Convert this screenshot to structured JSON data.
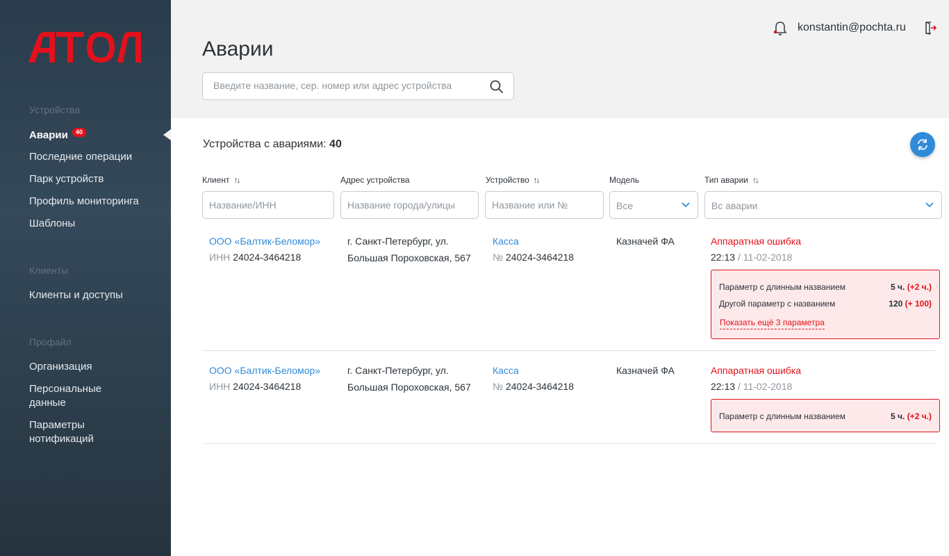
{
  "sidebar": {
    "logo_text": "АТОЛ",
    "sections": [
      {
        "title": "Устройства",
        "items": [
          {
            "label": "Аварии",
            "badge": "40",
            "active": true
          },
          {
            "label": "Последние операции"
          },
          {
            "label": "Парк устройств"
          },
          {
            "label": "Профиль мониторинга"
          },
          {
            "label": "Шаблоны"
          }
        ]
      },
      {
        "title": "Клиенты",
        "items": [
          {
            "label": "Клиенты и доступы"
          }
        ]
      },
      {
        "title": "Профайл",
        "items": [
          {
            "label": "Организация"
          },
          {
            "label": "Персональные данные"
          },
          {
            "label": "Параметры нотификаций"
          }
        ]
      }
    ]
  },
  "header": {
    "title": "Аварии",
    "search_placeholder": "Введите название, сер. номер или адрес устройства",
    "user_email": "konstantin@pochta.ru",
    "icons": [
      "bell-icon",
      "logout-icon",
      "search-icon"
    ]
  },
  "summary": {
    "label": "Устройства с авариями:",
    "count": "40"
  },
  "columns": [
    {
      "label": "Клиент",
      "sortable": true,
      "filter_placeholder": "Название/ИНН"
    },
    {
      "label": "Адрес устройства",
      "sortable": false,
      "filter_placeholder": "Название города/улицы"
    },
    {
      "label": "Устройство",
      "sortable": true,
      "filter_placeholder": "Название или №"
    },
    {
      "label": "Модель",
      "sortable": false,
      "filter_value": "Все"
    },
    {
      "label": "Тип аварии",
      "sortable": true,
      "filter_value": "Вс аварии"
    }
  ],
  "rows": [
    {
      "client_name": "ООО «Балтик-Беломор»",
      "client_inn_label": "ИНН",
      "client_inn": "24024-3464218",
      "address_line1": "г. Санкт-Петербург, ул.",
      "address_line2": "Большая Пороховская, 567",
      "device_name": "Касса",
      "device_no_label": "№",
      "device_no": "24024-3464218",
      "model": "Казначей ФА",
      "alarm_type": "Аппаратная ошибка",
      "alarm_time": "22:13",
      "alarm_date": "/ 11-02-2018",
      "params": [
        {
          "name": "Параметр с длинным названием",
          "value": "5 ч.",
          "delta": "(+2 ч.)"
        },
        {
          "name": "Другой параметр с названием",
          "value": "120",
          "delta": "(+ 100)"
        }
      ],
      "show_more": "Показать ещё 3 параметра"
    },
    {
      "client_name": "ООО «Балтик-Беломор»",
      "client_inn_label": "ИНН",
      "client_inn": "24024-3464218",
      "address_line1": "г. Санкт-Петербург, ул.",
      "address_line2": "Большая Пороховская, 567",
      "device_name": "Касса",
      "device_no_label": "№",
      "device_no": "24024-3464218",
      "model": "Казначей ФА",
      "alarm_type": "Аппаратная ошибка",
      "alarm_time": "22:13",
      "alarm_date": "/ 11-02-2018",
      "params": [
        {
          "name": "Параметр с длинным названием",
          "value": "5 ч.",
          "delta": "(+2 ч.)"
        }
      ]
    }
  ],
  "colors": {
    "accent": "#2f8ad9",
    "error": "#e3111b",
    "sidebar": "#2d3e4d"
  }
}
